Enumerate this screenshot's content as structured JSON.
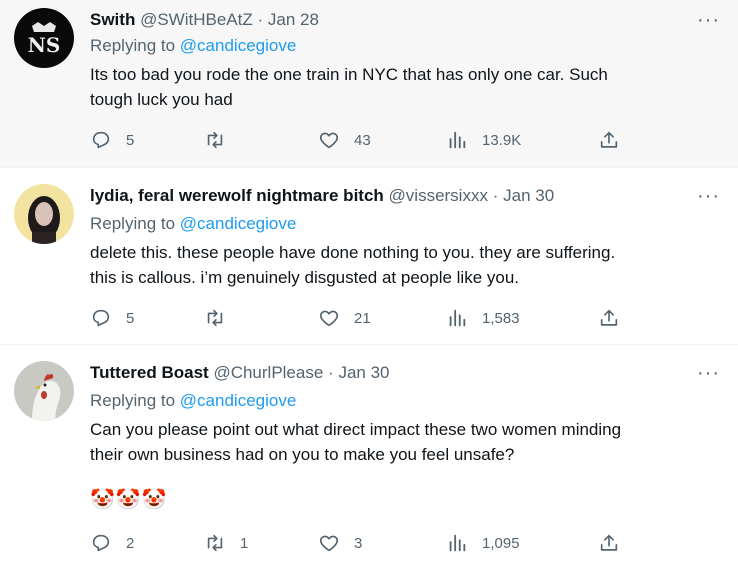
{
  "tweets": [
    {
      "name": "Swith",
      "handle": "@SWitHBeAtZ",
      "dot": "·",
      "date": "Jan 28",
      "replying_prefix": "Replying to",
      "replying_to": "@candicegiove",
      "text_lines": [
        "Its too bad you rode the one train in NYC that has only one car.  Such",
        "tough luck you had"
      ],
      "replies": "5",
      "retweets": "",
      "likes": "43",
      "views": "13.9K"
    },
    {
      "name": "lydia, feral werewolf nightmare bitch",
      "handle": "@vissersixxx",
      "dot": "·",
      "date": "Jan 30",
      "replying_prefix": "Replying to",
      "replying_to": "@candicegiove",
      "text_lines": [
        "delete this. these people have done nothing to you. they are suffering.",
        "this is callous. i’m genuinely disgusted at people like you."
      ],
      "replies": "5",
      "retweets": "",
      "likes": "21",
      "views": "1,583"
    },
    {
      "name": "Tuttered Boast",
      "handle": "@ChurlPlease",
      "dot": "·",
      "date": "Jan 30",
      "replying_prefix": "Replying to",
      "replying_to": "@candicegiove",
      "text_lines": [
        "Can you please point out what direct impact these two women minding",
        "their own business had on you to make you feel unsafe?"
      ],
      "emojis": "🤡🤡🤡",
      "replies": "2",
      "retweets": "1",
      "likes": "3",
      "views": "1,095"
    }
  ],
  "more_label": "···",
  "colors": {
    "accent": "#1d9bf0",
    "secondary": "#536471",
    "text": "#0f1419"
  }
}
